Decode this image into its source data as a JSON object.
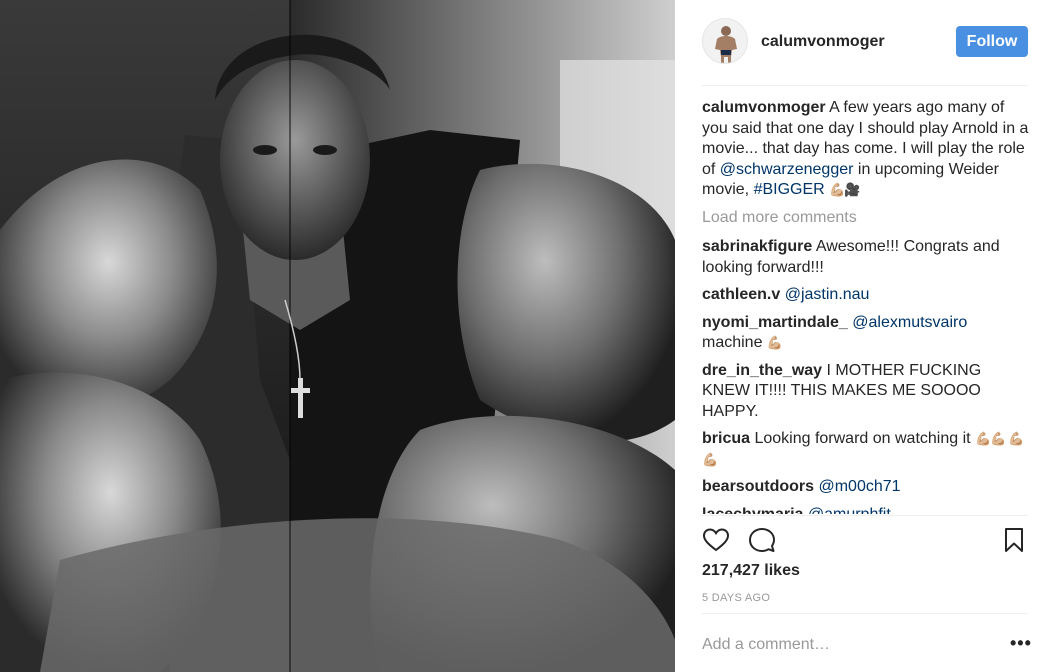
{
  "post": {
    "username": "calumvonmoger",
    "follow_label": "Follow",
    "caption": {
      "user": "calumvonmoger",
      "part1": " A few years ago many of you said that one day I should play Arnold in a movie... that day has come. I will play the role of ",
      "mention": "@schwarzenegger",
      "part2": " in upcoming Weider movie, ",
      "tag": "#BIGGER",
      "emoji": "💪🏼🎥"
    },
    "load_more": "Load more comments",
    "comments": [
      {
        "user": "sabrinakfigure",
        "text": " Awesome!!! Congrats and looking forward!!!",
        "mention": "",
        "emoji": ""
      },
      {
        "user": "cathleen.v",
        "text": " ",
        "mention": "@jastin.nau",
        "emoji": ""
      },
      {
        "user": "nyomi_martindale_",
        "text": " ",
        "mention": "@alexmutsvairo",
        "after": " machine ",
        "emoji": "💪🏼"
      },
      {
        "user": "dre_in_the_way",
        "text": " I MOTHER FUCKING KNEW IT!!!! THIS MAKES ME SOOOO HAPPY.",
        "mention": "",
        "emoji": ""
      },
      {
        "user": "bricua",
        "text": " Looking forward on watching it ",
        "mention": "",
        "emoji": "💪🏼💪🏼 💪🏼💪🏼"
      },
      {
        "user": "bearsoutdoors",
        "text": " ",
        "mention": "@m00ch71",
        "emoji": ""
      },
      {
        "user": "lacechymaria",
        "text": " ",
        "mention": "@amurphfit",
        "emoji": ""
      }
    ],
    "likes": "217,427 likes",
    "time": "5 DAYS AGO",
    "add_comment_placeholder": "Add a comment…",
    "more_options": "•••",
    "icons": {
      "like": "heart-outline-icon",
      "comment": "speech-bubble-icon",
      "save": "bookmark-icon"
    }
  }
}
